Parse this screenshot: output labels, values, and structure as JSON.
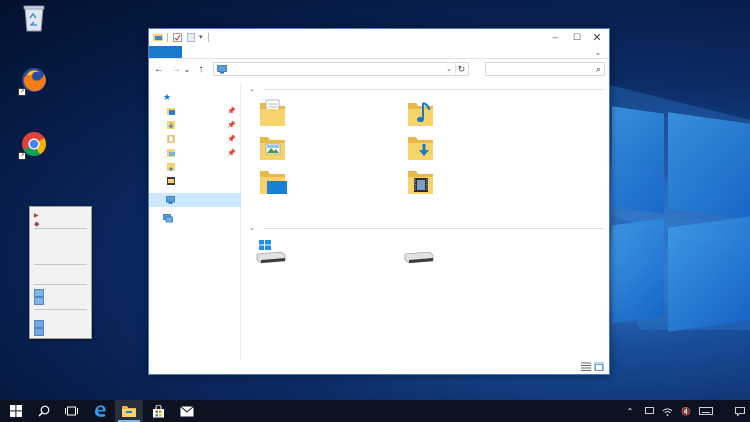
{
  "desktop": {
    "icons": [
      {
        "name": "recycle-bin-icon",
        "label": ""
      },
      {
        "name": "firefox-icon",
        "label": ""
      },
      {
        "name": "chrome-icon",
        "label": ""
      }
    ]
  },
  "context_menu": {
    "items": [
      "",
      "",
      "",
      ""
    ]
  },
  "explorer": {
    "window_title": "",
    "ribbon": {
      "file_tab_label": ""
    },
    "nav": {
      "back": "←",
      "forward": "→",
      "recent": "⌄",
      "up": "↑",
      "refresh": "↻",
      "search_glyph": "⌕"
    },
    "address_path": "",
    "search_placeholder": "",
    "nav_pane": {
      "quick_access_label": "",
      "this_pc_label": "",
      "network_label": ""
    },
    "groups": [
      {
        "header": ""
      },
      {
        "header": ""
      }
    ],
    "folders": [
      {
        "name": "documents-folder-icon",
        "label": ""
      },
      {
        "name": "music-folder-icon",
        "label": ""
      },
      {
        "name": "pictures-folder-icon",
        "label": ""
      },
      {
        "name": "downloads-folder-icon",
        "label": ""
      },
      {
        "name": "desktop-folder-icon",
        "label": ""
      },
      {
        "name": "videos-folder-icon",
        "label": ""
      }
    ],
    "drives": [
      {
        "name": "windows-drive-icon",
        "label": ""
      },
      {
        "name": "drive-icon",
        "label": ""
      }
    ],
    "status_text": ""
  },
  "taskbar": {
    "start_glyph": "⊞",
    "search_glyph": "⌕",
    "clock": ""
  },
  "colors": {
    "accent": "#1979ca",
    "selection": "#cce8ff",
    "folder_yellow": "#f6d36b",
    "taskbar": "#0b1220"
  }
}
